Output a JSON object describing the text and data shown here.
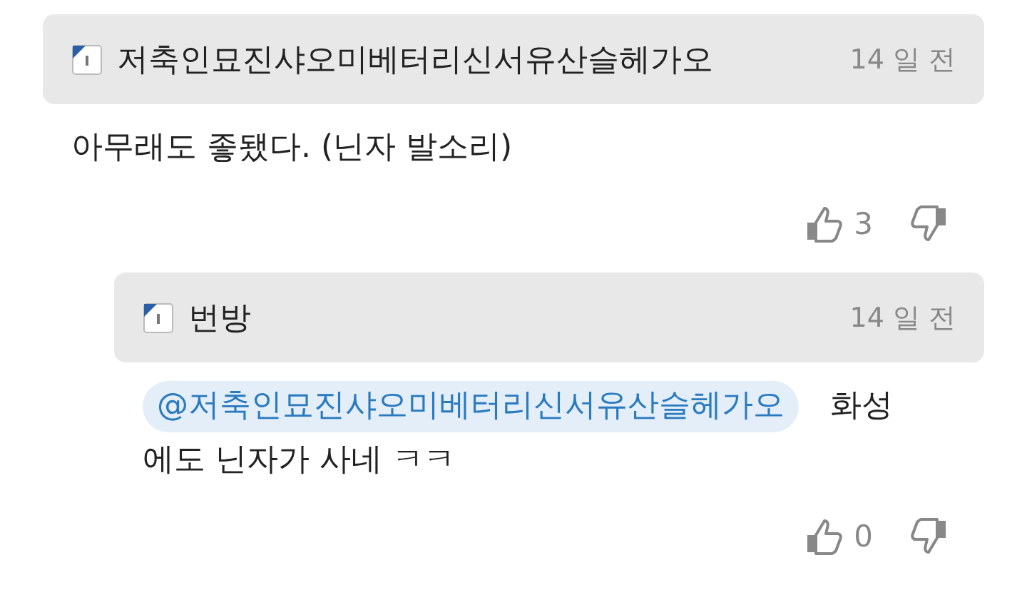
{
  "comments": [
    {
      "author": "저축인묘진샤오미베터리신서유산슬헤가오",
      "time": "14 일 전",
      "lines": [
        "아무래도 좋됐다. (닌자 발소리)"
      ],
      "likes": "3",
      "replies": [
        {
          "author": "번방",
          "time": "14 일 전",
          "mention": "@저축인묘진샤오미베터리신서유산슬헤가오",
          "lines": [
            "화성",
            "에도 닌자가 사네 ㅋㅋ"
          ],
          "likes": "0"
        }
      ]
    }
  ]
}
